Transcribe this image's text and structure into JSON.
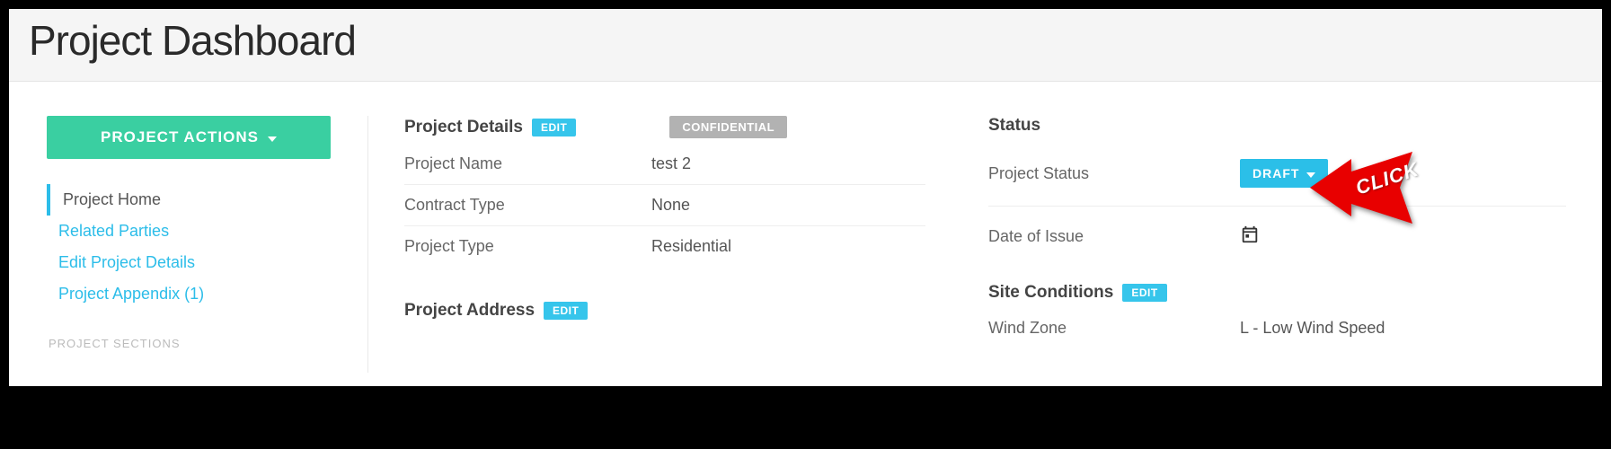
{
  "header": {
    "title": "Project Dashboard"
  },
  "sidebar": {
    "actions_label": "PROJECT ACTIONS",
    "nav": [
      {
        "label": "Project Home"
      },
      {
        "label": "Related Parties"
      },
      {
        "label": "Edit Project Details"
      },
      {
        "label": "Project Appendix (1)"
      }
    ],
    "footer_label": "PROJECT SECTIONS"
  },
  "details": {
    "title": "Project Details",
    "edit_label": "EDIT",
    "confidential_label": "CONFIDENTIAL",
    "rows": [
      {
        "label": "Project Name",
        "value": "test 2"
      },
      {
        "label": "Contract Type",
        "value": "None"
      },
      {
        "label": "Project Type",
        "value": "Residential"
      }
    ]
  },
  "address": {
    "title": "Project Address",
    "edit_label": "EDIT"
  },
  "status": {
    "title": "Status",
    "project_status_label": "Project Status",
    "draft_label": "DRAFT",
    "date_of_issue_label": "Date of Issue"
  },
  "site": {
    "title": "Site Conditions",
    "edit_label": "EDIT",
    "wind_zone_label": "Wind Zone",
    "wind_zone_value": "L - Low Wind Speed"
  },
  "annotation": {
    "click_label": "CLICK"
  }
}
